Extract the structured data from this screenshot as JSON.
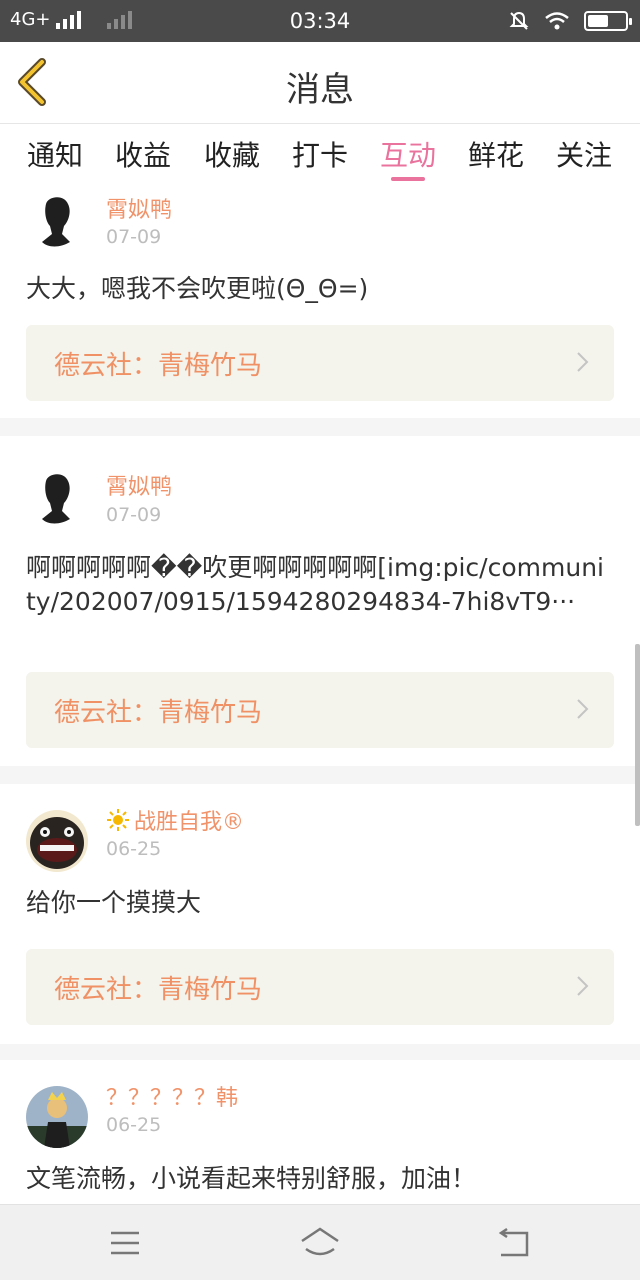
{
  "status_bar": {
    "network": "4G+",
    "time": "03:34"
  },
  "header": {
    "title": "消息"
  },
  "tabs": [
    {
      "label": "通知"
    },
    {
      "label": "收益"
    },
    {
      "label": "收藏"
    },
    {
      "label": "打卡"
    },
    {
      "label": "互动",
      "active": true
    },
    {
      "label": "鲜花"
    },
    {
      "label": "关注"
    }
  ],
  "messages": [
    {
      "username": "霄姒鸭",
      "date": "07-09",
      "text": "大大，嗯我不会吹更啦(Θ_Θ=)",
      "source": "德云社：青梅竹马"
    },
    {
      "username": "霄姒鸭",
      "date": "07-09",
      "text": "啊啊啊啊啊��吹更啊啊啊啊啊[img:pic/community/202007/0915/1594280294834-7hi8vT9···",
      "source": "德云社：青梅竹马"
    },
    {
      "username": "战胜自我®",
      "date": "06-25",
      "text": "给你一个摸摸大",
      "source": "德云社：青梅竹马"
    },
    {
      "username": "？？？？？韩",
      "date": "06-25",
      "text": "文笔流畅，小说看起来特别舒服，加油！"
    }
  ],
  "colors": {
    "accent": "#e9739d",
    "username": "#f0936a",
    "source_bg": "#f4f3ec"
  },
  "icons": [
    "back-icon",
    "chevron-right-icon",
    "sun-icon",
    "menu-icon",
    "home-icon",
    "back-nav-icon"
  ]
}
